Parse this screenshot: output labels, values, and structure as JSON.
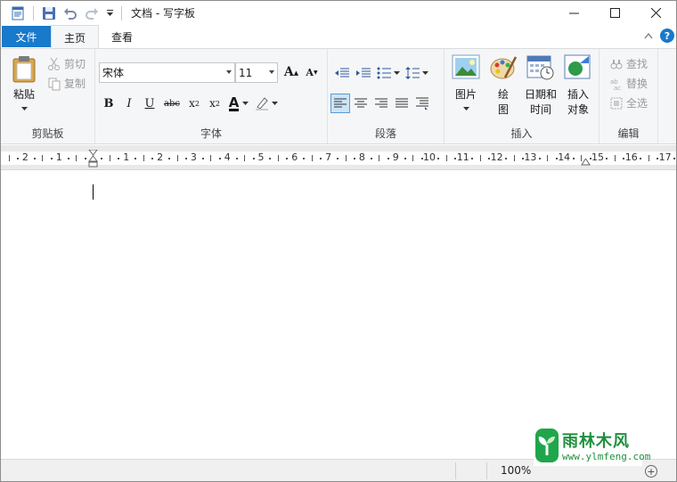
{
  "window": {
    "title": "文档 - 写字板"
  },
  "tabs": {
    "file": "文件",
    "home": "主页",
    "view": "查看"
  },
  "clipboard": {
    "label": "剪贴板",
    "paste": "粘贴",
    "cut": "剪切",
    "copy": "复制"
  },
  "font": {
    "label": "字体",
    "name": "宋体",
    "size": "11"
  },
  "paragraph": {
    "label": "段落"
  },
  "insert": {
    "label": "插入",
    "picture": "图片",
    "paint_l1": "绘",
    "paint_l2": "图",
    "datetime_l1": "日期和",
    "datetime_l2": "时间",
    "object_l1": "插入",
    "object_l2": "对象"
  },
  "edit": {
    "label": "编辑",
    "find": "查找",
    "replace": "替换",
    "select_all": "全选"
  },
  "ruler": {
    "numbers": [
      "2",
      "1",
      "1",
      "2",
      "3",
      "4",
      "5",
      "6",
      "7",
      "8",
      "9",
      "10",
      "11",
      "12",
      "13",
      "14",
      "15",
      "16",
      "17"
    ]
  },
  "status": {
    "zoom": "100%"
  },
  "watermark": {
    "line1": "雨林木风",
    "line2": "www.ylmfeng.com"
  },
  "colors": {
    "accent": "#1979ca",
    "ribbon_bg": "#f5f6f7",
    "watermark": "#1f8f3e"
  }
}
